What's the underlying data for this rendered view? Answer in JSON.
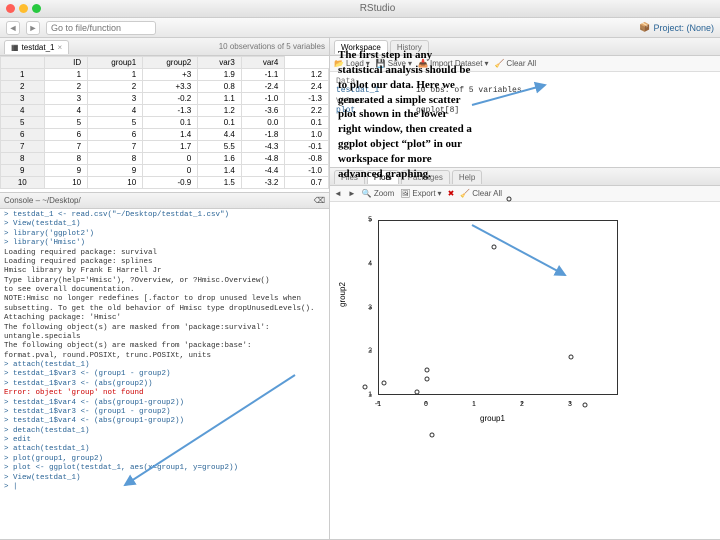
{
  "app_title": "RStudio",
  "search_placeholder": "Go to file/function",
  "project_label": "Project: (None)",
  "source": {
    "tab_label": "testdat_1",
    "info": "10 observations of 5 variables",
    "columns": [
      "ID",
      "group1",
      "group2",
      "var3",
      "var4"
    ],
    "rows": [
      [
        "1",
        "1",
        "+3",
        "1.9",
        "-1.1",
        "1.2"
      ],
      [
        "2",
        "2",
        "+3.3",
        "0.8",
        "-2.4",
        "2.4"
      ],
      [
        "3",
        "3",
        "-0.2",
        "1.1",
        "-1.0",
        "-1.3"
      ],
      [
        "4",
        "4",
        "-1.3",
        "1.2",
        "-3.6",
        "2.2"
      ],
      [
        "5",
        "5",
        "0.1",
        "0.1",
        "0.0",
        "0.1"
      ],
      [
        "6",
        "6",
        "1.4",
        "4.4",
        "-1.8",
        "1.0"
      ],
      [
        "7",
        "7",
        "1.7",
        "5.5",
        "-4.3",
        "-0.1"
      ],
      [
        "8",
        "8",
        "0",
        "1.6",
        "-4.8",
        "-0.8"
      ],
      [
        "9",
        "9",
        "0",
        "1.4",
        "-4.4",
        "-1.0"
      ],
      [
        "10",
        "10",
        "-0.9",
        "1.5",
        "-3.2",
        "0.7"
      ]
    ]
  },
  "console": {
    "header": "Console – ~/Desktop/",
    "lines": [
      {
        "t": "cmd",
        "s": "> testdat_1 <- read.csv(\"~/Desktop/testdat_1.csv\")"
      },
      {
        "t": "cmd",
        "s": "> View(testdat_1)"
      },
      {
        "t": "cmd",
        "s": "> library('ggplot2')"
      },
      {
        "t": "cmd",
        "s": "> library('Hmisc')"
      },
      {
        "t": "out",
        "s": "Loading required package: survival"
      },
      {
        "t": "out",
        "s": "Loading required package: splines"
      },
      {
        "t": "out",
        "s": "Hmisc library by Frank E Harrell Jr"
      },
      {
        "t": "out",
        "s": ""
      },
      {
        "t": "out",
        "s": "Type library(help='Hmisc'), ?Overview, or ?Hmisc.Overview()"
      },
      {
        "t": "out",
        "s": "to see overall documentation."
      },
      {
        "t": "out",
        "s": ""
      },
      {
        "t": "out",
        "s": "NOTE:Hmisc no longer redefines [.factor to drop unused levels when"
      },
      {
        "t": "out",
        "s": "subsetting.  To get the old behavior of Hmisc type dropUnusedLevels()."
      },
      {
        "t": "out",
        "s": ""
      },
      {
        "t": "out",
        "s": "Attaching package: 'Hmisc'"
      },
      {
        "t": "out",
        "s": ""
      },
      {
        "t": "out",
        "s": "The following object(s) are masked from 'package:survival':"
      },
      {
        "t": "out",
        "s": ""
      },
      {
        "t": "out",
        "s": "    untangle.specials"
      },
      {
        "t": "out",
        "s": ""
      },
      {
        "t": "out",
        "s": "The following object(s) are masked from 'package:base':"
      },
      {
        "t": "out",
        "s": ""
      },
      {
        "t": "out",
        "s": "    format.pval, round.POSIXt, trunc.POSIXt, units"
      },
      {
        "t": "out",
        "s": ""
      },
      {
        "t": "cmd",
        "s": "> attach(testdat_1)"
      },
      {
        "t": "cmd",
        "s": "> testdat_1$var3 <- (group1 - group2)"
      },
      {
        "t": "cmd",
        "s": "> testdat_1$var3 <- (abs(group2))"
      },
      {
        "t": "err",
        "s": "Error: object 'group' not found"
      },
      {
        "t": "cmd",
        "s": "> testdat_1$var4 <- (abs(group1-group2))"
      },
      {
        "t": "cmd",
        "s": "> testdat_1$var3 <- (group1 - group2)"
      },
      {
        "t": "cmd",
        "s": "> testdat_1$var4 <- (abs(group1-group2))"
      },
      {
        "t": "cmd",
        "s": "> detach(testdat_1)"
      },
      {
        "t": "cmd",
        "s": "> edit"
      },
      {
        "t": "cmd",
        "s": "> attach(testdat_1)"
      },
      {
        "t": "cmd",
        "s": "> plot(group1, group2)"
      },
      {
        "t": "cmd",
        "s": "> plot <- ggplot(testdat_1, aes(x=group1, y=group2))"
      },
      {
        "t": "cmd",
        "s": "> View(testdat_1)"
      },
      {
        "t": "cmd",
        "s": "> |"
      }
    ]
  },
  "workspace": {
    "tabs": [
      "Workspace",
      "History"
    ],
    "toolbar": {
      "load": "Load",
      "save": "Save",
      "import": "Import Dataset",
      "clear": "Clear All"
    },
    "sections": {
      "data_label": "Data",
      "data_name": "testdat_1",
      "data_desc": "10 obs. of 5 variables",
      "values_label": "Values",
      "val_name": "plot",
      "val_desc": "ggplot[8]"
    }
  },
  "plots": {
    "tabs": [
      "Files",
      "Plots",
      "Packages",
      "Help"
    ],
    "toolbar": {
      "zoom": "Zoom",
      "export": "Export",
      "clear": "Clear All"
    }
  },
  "chart_data": {
    "type": "scatter",
    "xlabel": "group1",
    "ylabel": "group2",
    "xlim": [
      -1,
      4
    ],
    "ylim": [
      1,
      5
    ],
    "xticks": [
      -1,
      0,
      1,
      2,
      3
    ],
    "yticks": [
      1,
      2,
      3,
      4,
      5
    ],
    "points": [
      {
        "x": 3.0,
        "y": 1.9
      },
      {
        "x": 3.3,
        "y": 0.8
      },
      {
        "x": -0.2,
        "y": 1.1
      },
      {
        "x": -1.3,
        "y": 1.2
      },
      {
        "x": 0.1,
        "y": 0.1
      },
      {
        "x": 1.4,
        "y": 4.4
      },
      {
        "x": 1.7,
        "y": 5.5
      },
      {
        "x": 0.0,
        "y": 1.6
      },
      {
        "x": 0.0,
        "y": 1.4
      },
      {
        "x": -0.9,
        "y": 1.3
      }
    ]
  },
  "overlay_text": "The first step in any statistical analysis should be to plot our data. Here we generated a simple scatter plot shown in the lower right window, then created a ggplot object “plot” in our workspace for more advanced graphing."
}
